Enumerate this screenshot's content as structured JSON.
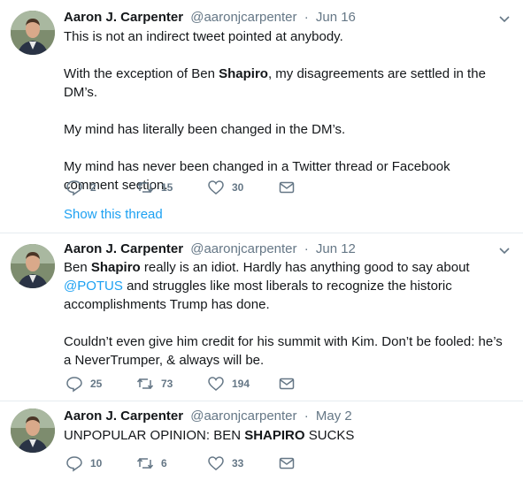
{
  "tweets": [
    {
      "name": "Aaron J. Carpenter",
      "handle": "@aaronjcarpenter",
      "separator": "·",
      "date": "Jun 16",
      "paragraphs": [
        "This is not an indirect tweet pointed at anybody.",
        [
          "With the exception of Ben ",
          "Shapiro",
          ", my disagreements are settled in the DM’s."
        ],
        "My mind has literally been changed in the DM’s.",
        "My mind has never been changed in a Twitter thread or Facebook comment section."
      ],
      "replies": "2",
      "retweets": "15",
      "likes": "30",
      "show_thread": "Show this thread"
    },
    {
      "name": "Aaron J. Carpenter",
      "handle": "@aaronjcarpenter",
      "separator": "·",
      "date": "Jun 12",
      "p1_a": "Ben ",
      "p1_bold": "Shapiro",
      "p1_b": " really is an idiot. Hardly has anything good to say about ",
      "p1_mention": "@POTUS",
      "p1_c": " and struggles like most liberals to recognize the historic accomplishments Trump has done.",
      "p2": "Couldn’t even give him credit for his summit with Kim. Don’t be fooled: he’s a NeverTrumper, & always will be.",
      "replies": "25",
      "retweets": "73",
      "likes": "194"
    },
    {
      "name": "Aaron J. Carpenter",
      "handle": "@aaronjcarpenter",
      "separator": "·",
      "date": "May 2",
      "p1_a": "UNPOPULAR OPINION: BEN ",
      "p1_bold": "SHAPIRO",
      "p1_b": " SUCKS",
      "replies": "10",
      "retweets": "6",
      "likes": "33"
    }
  ],
  "icons": {
    "reply": "reply-icon",
    "retweet": "retweet-icon",
    "like": "heart-icon",
    "dm": "envelope-icon",
    "caret": "chevron-down-icon"
  },
  "colors": {
    "link": "#1da1f2",
    "secondary_text": "#657786",
    "divider": "#e6ecf0"
  }
}
